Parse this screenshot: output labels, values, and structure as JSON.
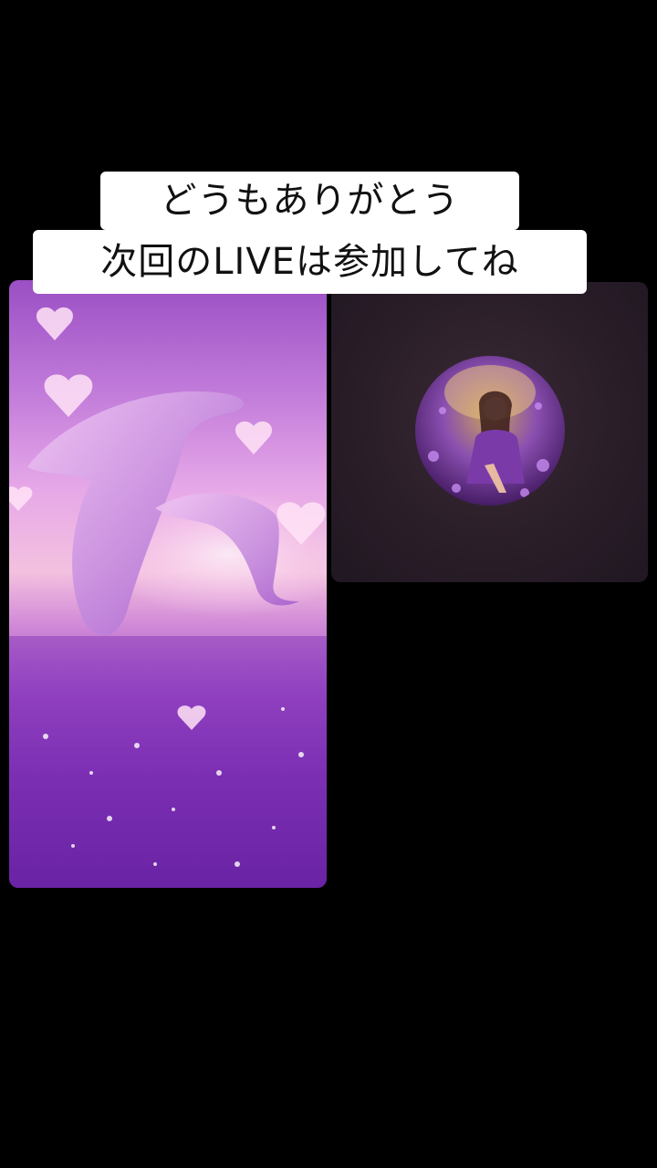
{
  "caption": {
    "line1": "どうもありがとう",
    "line2": "次回のLIVEは参加してね"
  },
  "colors": {
    "background": "#000000",
    "caption_bg": "#ffffff",
    "caption_text": "#111111",
    "right_panel_bg": "#2a1e28",
    "left_panel_accent": "#b56ad6"
  },
  "left_panel": {
    "image": "dolphins-hearts-image"
  },
  "right_panel": {
    "avatar": "avatar-image"
  }
}
